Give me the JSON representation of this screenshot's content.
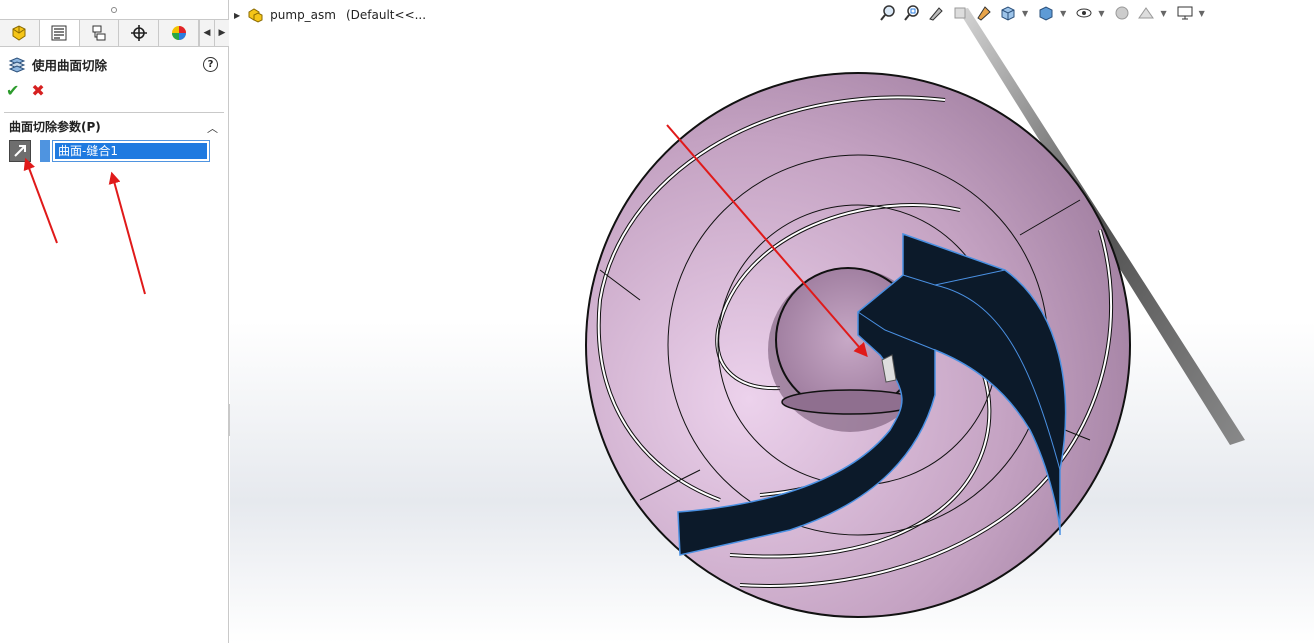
{
  "panel": {
    "tabs": [
      {
        "icon": "feature-manager-icon"
      },
      {
        "icon": "property-manager-icon"
      },
      {
        "icon": "configuration-manager-icon"
      },
      {
        "icon": "dimxpert-icon"
      },
      {
        "icon": "appearance-icon"
      }
    ],
    "title": "使用曲面切除",
    "help": "?",
    "ok": "✔",
    "cancel": "✖",
    "group_title": "曲面切除参数(P)",
    "selection_item": "曲面-缝合1"
  },
  "viewport": {
    "tree_label": "pump_asm",
    "tree_config": "(Default<<..."
  },
  "toolbar": {
    "icons": [
      "zoom-to-fit-icon",
      "zoom-area-icon",
      "previous-view-icon",
      "section-view-icon",
      "dynamic-annotation-icon",
      "view-orientation-icon",
      "display-style-icon",
      "hide-show-items-icon",
      "edit-appearance-icon",
      "apply-scene-icon",
      "view-settings-icon"
    ]
  },
  "colors": {
    "part": "#b594b3",
    "blade_highlight": "#4a90e2",
    "annotation_arrow": "#e01a1a",
    "selection": "#1f7ae0"
  }
}
